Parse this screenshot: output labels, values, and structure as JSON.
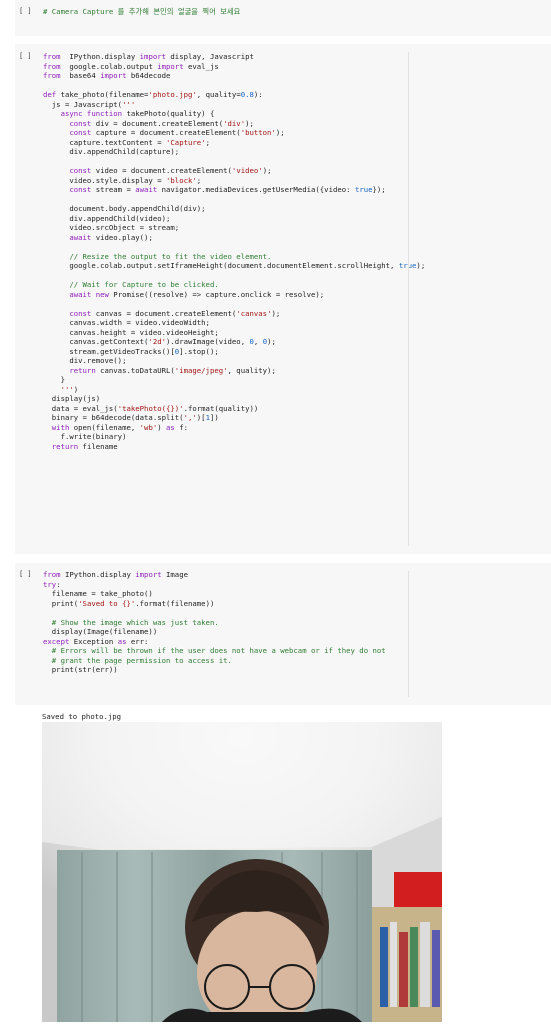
{
  "cells": [
    {
      "run_label": "[ ]",
      "lines": [
        [
          [
            "c",
            "# Camera Capture 를 추가해 본인의 얼굴을 찍어 보세요"
          ]
        ]
      ]
    },
    {
      "run_label": "[ ]",
      "lines": [
        [
          [
            "k",
            "from"
          ],
          [
            "",
            "  IPython.display "
          ],
          [
            "k",
            "import"
          ],
          [
            "",
            " display, Javascript"
          ]
        ],
        [
          [
            "k",
            "from"
          ],
          [
            "",
            "  google.colab.output "
          ],
          [
            "k",
            "import"
          ],
          [
            "",
            " eval_js"
          ]
        ],
        [
          [
            "k",
            "from"
          ],
          [
            "",
            "  base64 "
          ],
          [
            "k",
            "import"
          ],
          [
            "",
            " b64decode"
          ]
        ],
        [
          [
            "",
            ""
          ]
        ],
        [
          [
            "k",
            "def"
          ],
          [
            "",
            " take_photo(filename="
          ],
          [
            "s",
            "'photo.jpg'"
          ],
          [
            "",
            ", quality="
          ],
          [
            "n",
            "0.8"
          ],
          [
            "",
            "):"
          ]
        ],
        [
          [
            "",
            "  js = Javascript("
          ],
          [
            "s",
            "'''"
          ]
        ],
        [
          [
            "k",
            "    async function"
          ],
          [
            "",
            " takePhoto(quality) {"
          ]
        ],
        [
          [
            "k",
            "      const"
          ],
          [
            "",
            " div = document.createElement("
          ],
          [
            "s",
            "'div'"
          ],
          [
            "",
            ");"
          ]
        ],
        [
          [
            "k",
            "      const"
          ],
          [
            "",
            " capture = document.createElement("
          ],
          [
            "s",
            "'button'"
          ],
          [
            "",
            ");"
          ]
        ],
        [
          [
            "",
            "      capture.textContent = "
          ],
          [
            "s",
            "'Capture'"
          ],
          [
            "",
            ";"
          ]
        ],
        [
          [
            "",
            "      div.appendChild(capture);"
          ]
        ],
        [
          [
            "",
            ""
          ]
        ],
        [
          [
            "k",
            "      const"
          ],
          [
            "",
            " video = document.createElement("
          ],
          [
            "s",
            "'video'"
          ],
          [
            "",
            ");"
          ]
        ],
        [
          [
            "",
            "      video.style.display = "
          ],
          [
            "s",
            "'block'"
          ],
          [
            "",
            ";"
          ]
        ],
        [
          [
            "k",
            "      const"
          ],
          [
            "",
            " stream = "
          ],
          [
            "k",
            "await"
          ],
          [
            "",
            " navigator.mediaDevices.getUserMedia({video: "
          ],
          [
            "n",
            "true"
          ],
          [
            "",
            "});"
          ]
        ],
        [
          [
            "",
            ""
          ]
        ],
        [
          [
            "",
            "      document.body.appendChild(div);"
          ]
        ],
        [
          [
            "",
            "      div.appendChild(video);"
          ]
        ],
        [
          [
            "",
            "      video.srcObject = stream;"
          ]
        ],
        [
          [
            "k",
            "      await"
          ],
          [
            "",
            " video.play();"
          ]
        ],
        [
          [
            "",
            ""
          ]
        ],
        [
          [
            "c",
            "      // Resize the output to fit the video element."
          ]
        ],
        [
          [
            "",
            "      google.colab.output.setIframeHeight(document.documentElement.scrollHeight, "
          ],
          [
            "n",
            "true"
          ],
          [
            "",
            ");"
          ]
        ],
        [
          [
            "",
            ""
          ]
        ],
        [
          [
            "c",
            "      // Wait for Capture to be clicked."
          ]
        ],
        [
          [
            "k",
            "      await new"
          ],
          [
            "",
            " Promise((resolve) => capture.onclick = resolve);"
          ]
        ],
        [
          [
            "",
            ""
          ]
        ],
        [
          [
            "k",
            "      const"
          ],
          [
            "",
            " canvas = document.createElement("
          ],
          [
            "s",
            "'canvas'"
          ],
          [
            "",
            ");"
          ]
        ],
        [
          [
            "",
            "      canvas.width = video.videoWidth;"
          ]
        ],
        [
          [
            "",
            "      canvas.height = video.videoHeight;"
          ]
        ],
        [
          [
            "",
            "      canvas.getContext("
          ],
          [
            "s",
            "'2d'"
          ],
          [
            "",
            ").drawImage(video, "
          ],
          [
            "n",
            "0"
          ],
          [
            "",
            ", "
          ],
          [
            "n",
            "0"
          ],
          [
            "",
            ");"
          ]
        ],
        [
          [
            "",
            "      stream.getVideoTracks()["
          ],
          [
            "n",
            "0"
          ],
          [
            "",
            "].stop();"
          ]
        ],
        [
          [
            "",
            "      div.remove();"
          ]
        ],
        [
          [
            "k",
            "      return"
          ],
          [
            "",
            " canvas.toDataURL("
          ],
          [
            "s",
            "'image/jpeg'"
          ],
          [
            "",
            ", quality);"
          ]
        ],
        [
          [
            "",
            "    }"
          ]
        ],
        [
          [
            "s",
            "    '''"
          ],
          [
            "",
            ")"
          ]
        ],
        [
          [
            "",
            "  display(js)"
          ]
        ],
        [
          [
            "",
            "  data = eval_js("
          ],
          [
            "s",
            "'takePhoto({})'"
          ],
          [
            "",
            ".format(quality))"
          ]
        ],
        [
          [
            "",
            "  binary = b64decode(data.split("
          ],
          [
            "s",
            "','"
          ],
          [
            "",
            ")["
          ],
          [
            "n",
            "1"
          ],
          [
            "",
            "])"
          ]
        ],
        [
          [
            "k",
            "  with"
          ],
          [
            "",
            " open(filename, "
          ],
          [
            "s",
            "'wb'"
          ],
          [
            "",
            ") "
          ],
          [
            "k",
            "as"
          ],
          [
            "",
            " f:"
          ]
        ],
        [
          [
            "",
            "    f.write(binary)"
          ]
        ],
        [
          [
            "k",
            "  return"
          ],
          [
            "",
            " filename"
          ]
        ]
      ]
    },
    {
      "run_label": "[ ]",
      "lines": [
        [
          [
            "k",
            "from"
          ],
          [
            "",
            " IPython.display "
          ],
          [
            "k",
            "import"
          ],
          [
            "",
            " Image"
          ]
        ],
        [
          [
            "k",
            "try"
          ],
          [
            "",
            ":"
          ]
        ],
        [
          [
            "",
            "  filename = take_photo()"
          ]
        ],
        [
          [
            "",
            "  print("
          ],
          [
            "s",
            "'Saved to {}'"
          ],
          [
            "",
            ".format(filename))"
          ]
        ],
        [
          [
            "",
            ""
          ]
        ],
        [
          [
            "c",
            "  # Show the image which was just taken."
          ]
        ],
        [
          [
            "",
            "  display(Image(filename))"
          ]
        ],
        [
          [
            "k",
            "except"
          ],
          [
            "",
            " Exception "
          ],
          [
            "k",
            "as"
          ],
          [
            "",
            " err:"
          ]
        ],
        [
          [
            "c",
            "  # Errors will be thrown if the user does not have a webcam or if they do not"
          ]
        ],
        [
          [
            "c",
            "  # grant the page permission to access it."
          ]
        ],
        [
          [
            "",
            "  print(str(err))"
          ]
        ]
      ]
    }
  ],
  "output": {
    "text": "Saved to photo.jpg"
  }
}
